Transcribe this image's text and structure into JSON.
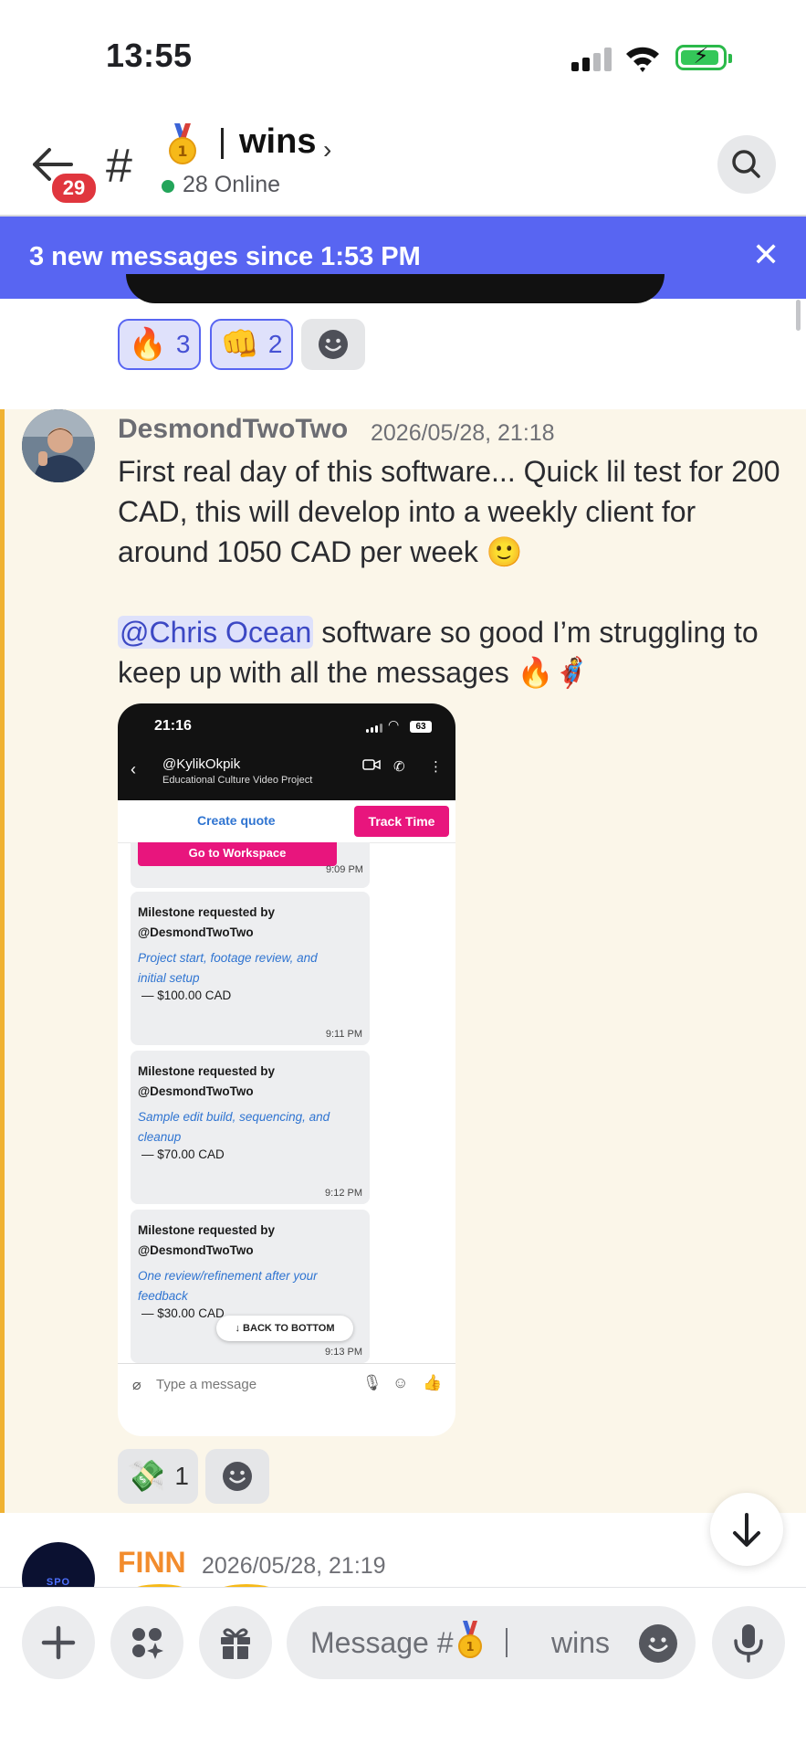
{
  "status_bar": {
    "time": "13:55",
    "battery_icon": "battery-charging-icon",
    "signal_icon": "cellular-signal-icon",
    "wifi_icon": "wifi-icon"
  },
  "header": {
    "unread_count": "29",
    "channel_name": "wins",
    "online_text": "28 Online",
    "medal_icon": "first-place-medal-icon"
  },
  "banner": {
    "text": "3 new messages since 1:53 PM"
  },
  "reactions_top": [
    {
      "emoji": "🔥",
      "count": "3"
    },
    {
      "emoji": "👊",
      "count": "2"
    }
  ],
  "message1": {
    "author": "DesmondTwoTwo",
    "timestamp": "2026/05/28, 21:18",
    "para1": "First real day of this software... Quick lil test for 200 CAD, this will develop into a weekly client for around 1050 CAD per week 🙂",
    "mention": "@Chris Ocean",
    "para2": " software so good I’m struggling to keep up with all the messages 🔥🦸",
    "attachment": {
      "time": "21:16",
      "battery": "63",
      "contact": "@KylikOkpik",
      "project": "Educational Culture Video Project",
      "create_quote": "Create quote",
      "track_time": "Track Time",
      "goto_workspace": "Go to Workspace",
      "first_time": "9:09 PM",
      "cards": [
        {
          "title": "Milestone requested by @DesmondTwoTwo",
          "desc": "Project start, footage review, and initial setup",
          "amount": "— $100.00 CAD",
          "time": "9:11 PM"
        },
        {
          "title": "Milestone requested by @DesmondTwoTwo",
          "desc": "Sample edit build, sequencing, and cleanup",
          "amount": "— $70.00 CAD",
          "time": "9:12 PM"
        },
        {
          "title": "Milestone requested by @DesmondTwoTwo",
          "desc": "One review/refinement after your feedback",
          "amount": "— $30.00 CAD",
          "time": "9:13 PM"
        }
      ],
      "back_to_bottom": "↓  BACK TO BOTTOM",
      "input_placeholder": "Type a message"
    },
    "reaction": {
      "emoji": "💸",
      "count": "1"
    }
  },
  "message2": {
    "author": "FINN",
    "timestamp": "2026/05/28, 21:19",
    "avatar_text": "SPO"
  },
  "composer": {
    "placeholder": "Message #",
    "channel": "wins"
  },
  "colors": {
    "blurple": "#5865f2",
    "highlight_bg": "#fbf6e9",
    "highlight_stripe": "#f0b232",
    "finn": "#f28c2d",
    "badge": "#e0363e"
  }
}
